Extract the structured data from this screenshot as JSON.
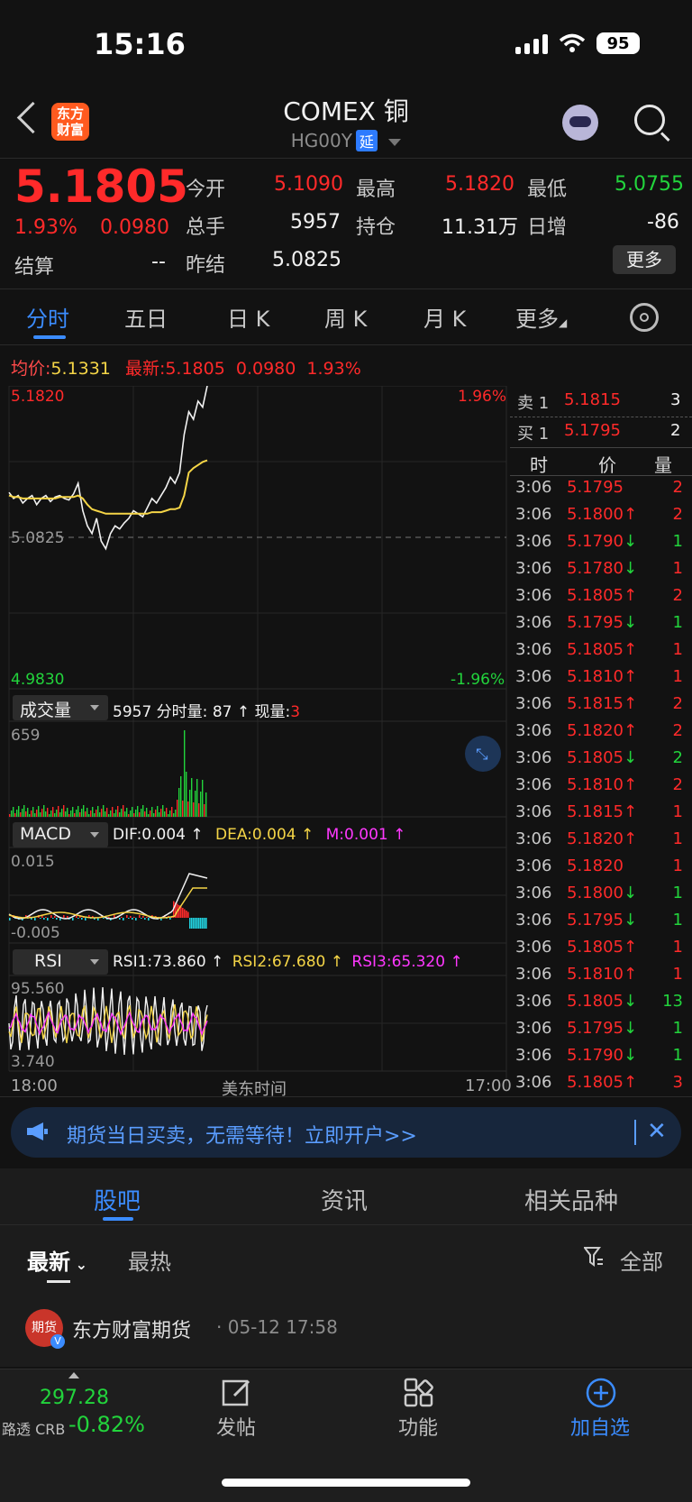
{
  "status": {
    "time": "15:16",
    "battery": "95"
  },
  "header": {
    "logo": "东方\n财富",
    "title": "COMEX 铜",
    "code": "HG00Y",
    "delay_badge": "延"
  },
  "quote": {
    "price": "5.1805",
    "change_pct": "1.93%",
    "change": "0.0980",
    "settle_label": "结算",
    "settle_value": "--",
    "open_label": "今开",
    "open_value": "5.1090",
    "high_label": "最高",
    "high_value": "5.1820",
    "low_label": "最低",
    "low_value": "5.0755",
    "volume_label": "总手",
    "volume_value": "5957",
    "oi_label": "持仓",
    "oi_value": "11.31万",
    "daily_inc_label": "日增",
    "daily_inc_value": "-86",
    "prev_settle_label": "昨结",
    "prev_settle_value": "5.0825",
    "more_button": "更多"
  },
  "tabs": [
    "分时",
    "五日",
    "日 K",
    "周 K",
    "月 K",
    "更多"
  ],
  "info_line": {
    "avg_label": "均价:",
    "avg_value": "5.1331",
    "latest_label": "最新:",
    "latest_value": "5.1805",
    "latest_change": "0.0980",
    "latest_pct": "1.93%"
  },
  "chart_labels": {
    "top_price": "5.1820",
    "top_pct": "1.96%",
    "mid_price": "5.0825",
    "bottom_price": "4.9830",
    "bottom_pct": "-1.96%",
    "vol_selector": "成交量",
    "vol_info_total": "5957",
    "vol_info_min_label": "分时量:",
    "vol_info_min": "87 ↑",
    "vol_info_cur_label": "现量:",
    "vol_info_cur": "3",
    "vol_axis": "659",
    "macd_selector": "MACD",
    "macd_dif": "DIF:0.004 ↑",
    "macd_dea": "DEA:0.004 ↑",
    "macd_m": "M:0.001 ↑",
    "macd_top": "0.015",
    "macd_bottom": "-0.005",
    "rsi_selector": "RSI",
    "rsi1": "RSI1:73.860 ↑",
    "rsi2": "RSI2:67.680 ↑",
    "rsi3": "RSI3:65.320 ↑",
    "rsi_top": "95.560",
    "rsi_bottom": "3.740",
    "time_start": "18:00",
    "time_mid": "美东时间",
    "time_end": "17:00"
  },
  "chart_data": {
    "type": "line",
    "title": "",
    "ylim": [
      4.983,
      5.182
    ],
    "reference": 5.0825,
    "series": [
      {
        "name": "",
        "values": [
          5.112,
          5.108,
          5.11,
          5.105,
          5.108,
          5.11,
          5.104,
          5.108,
          5.11,
          5.106,
          5.109,
          5.11,
          5.108,
          5.107,
          5.111,
          5.118,
          5.1,
          5.09,
          5.085,
          5.095,
          5.08,
          5.075,
          5.085,
          5.09,
          5.088,
          5.092,
          5.095,
          5.1,
          5.098,
          5.096,
          5.102,
          5.108,
          5.105,
          5.11,
          5.115,
          5.122,
          5.118,
          5.125,
          5.15,
          5.165,
          5.16,
          5.172,
          5.168,
          5.182
        ]
      },
      {
        "name": "均价",
        "values": [
          5.11,
          5.109,
          5.109,
          5.108,
          5.108,
          5.108,
          5.108,
          5.108,
          5.108,
          5.108,
          5.108,
          5.109,
          5.109,
          5.109,
          5.109,
          5.11,
          5.108,
          5.104,
          5.101,
          5.1,
          5.099,
          5.098,
          5.098,
          5.098,
          5.098,
          5.098,
          5.098,
          5.098,
          5.098,
          5.098,
          5.098,
          5.099,
          5.099,
          5.099,
          5.1,
          5.101,
          5.101,
          5.102,
          5.11,
          5.125,
          5.128,
          5.13,
          5.132,
          5.1331
        ]
      }
    ],
    "volume_max": 659
  },
  "orderbook": {
    "ask_label": "卖 1",
    "ask_price": "5.1815",
    "ask_qty": "3",
    "bid_label": "买 1",
    "bid_price": "5.1795",
    "bid_qty": "2",
    "col_time": "时",
    "col_price": "价",
    "col_qty": "量"
  },
  "trades": [
    {
      "time": "3:06",
      "price": "5.1795",
      "arrow": "",
      "qty": "2",
      "pc": "red",
      "qc": "red"
    },
    {
      "time": "3:06",
      "price": "5.1800↑",
      "arrow": "",
      "qty": "2",
      "pc": "red",
      "qc": "red"
    },
    {
      "time": "3:06",
      "price": "5.1790↓",
      "arrow": "",
      "qty": "1",
      "pc": "red",
      "qc": "green"
    },
    {
      "time": "3:06",
      "price": "5.1780↓",
      "arrow": "",
      "qty": "1",
      "pc": "red",
      "qc": "red"
    },
    {
      "time": "3:06",
      "price": "5.1805↑",
      "arrow": "",
      "qty": "2",
      "pc": "red",
      "qc": "red"
    },
    {
      "time": "3:06",
      "price": "5.1795↓",
      "arrow": "",
      "qty": "1",
      "pc": "red",
      "qc": "green"
    },
    {
      "time": "3:06",
      "price": "5.1805↑",
      "arrow": "",
      "qty": "1",
      "pc": "red",
      "qc": "red"
    },
    {
      "time": "3:06",
      "price": "5.1810↑",
      "arrow": "",
      "qty": "1",
      "pc": "red",
      "qc": "red"
    },
    {
      "time": "3:06",
      "price": "5.1815↑",
      "arrow": "",
      "qty": "2",
      "pc": "red",
      "qc": "red"
    },
    {
      "time": "3:06",
      "price": "5.1820↑",
      "arrow": "",
      "qty": "2",
      "pc": "red",
      "qc": "red"
    },
    {
      "time": "3:06",
      "price": "5.1805↓",
      "arrow": "",
      "qty": "2",
      "pc": "red",
      "qc": "green"
    },
    {
      "time": "3:06",
      "price": "5.1810↑",
      "arrow": "",
      "qty": "2",
      "pc": "red",
      "qc": "red"
    },
    {
      "time": "3:06",
      "price": "5.1815↑",
      "arrow": "",
      "qty": "1",
      "pc": "red",
      "qc": "red"
    },
    {
      "time": "3:06",
      "price": "5.1820↑",
      "arrow": "",
      "qty": "1",
      "pc": "red",
      "qc": "red"
    },
    {
      "time": "3:06",
      "price": "5.1820",
      "arrow": "",
      "qty": "1",
      "pc": "red",
      "qc": "red"
    },
    {
      "time": "3:06",
      "price": "5.1800↓",
      "arrow": "",
      "qty": "1",
      "pc": "red",
      "qc": "green"
    },
    {
      "time": "3:06",
      "price": "5.1795↓",
      "arrow": "",
      "qty": "1",
      "pc": "red",
      "qc": "green"
    },
    {
      "time": "3:06",
      "price": "5.1805↑",
      "arrow": "",
      "qty": "1",
      "pc": "red",
      "qc": "red"
    },
    {
      "time": "3:06",
      "price": "5.1810↑",
      "arrow": "",
      "qty": "1",
      "pc": "red",
      "qc": "red"
    },
    {
      "time": "3:06",
      "price": "5.1805↓",
      "arrow": "",
      "qty": "13",
      "pc": "red",
      "qc": "green"
    },
    {
      "time": "3:06",
      "price": "5.1795↓",
      "arrow": "",
      "qty": "1",
      "pc": "red",
      "qc": "green"
    },
    {
      "time": "3:06",
      "price": "5.1790↓",
      "arrow": "",
      "qty": "1",
      "pc": "red",
      "qc": "green"
    },
    {
      "time": "3:06",
      "price": "5.1805↑",
      "arrow": "",
      "qty": "3",
      "pc": "red",
      "qc": "red"
    }
  ],
  "banner": {
    "text": "期货当日买卖，无需等待！立即开户>>"
  },
  "lower_tabs": [
    "股吧",
    "资讯",
    "相关品种"
  ],
  "sub_tabs": {
    "latest": "最新",
    "hot": "最热",
    "filter": "全部"
  },
  "post": {
    "avatar": "期货",
    "author": "东方财富期货",
    "time": "· 05-12 17:58"
  },
  "bottom": {
    "index_value": "297.28",
    "index_name": "路透 CRB",
    "index_change": "-0.82%",
    "post_btn": "发帖",
    "func_btn": "功能",
    "add_btn": "加自选"
  }
}
